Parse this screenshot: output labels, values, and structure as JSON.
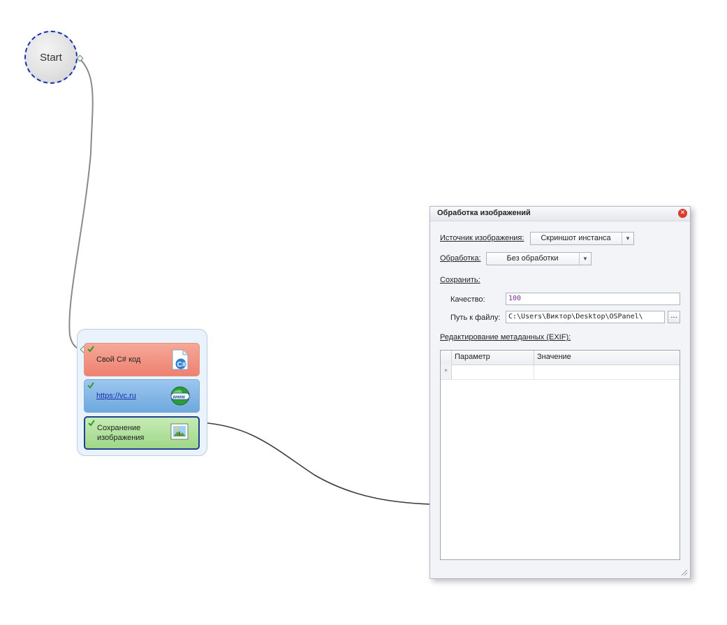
{
  "start_node": {
    "label": "Start"
  },
  "group": {
    "blocks": [
      {
        "label": "Свой C# код",
        "icon": "csharp-file-icon",
        "color": "#ee8170"
      },
      {
        "label": "https://vc.ru",
        "icon": "www-globe-icon",
        "color": "#6fa8de"
      },
      {
        "label_line1": "Сохранение",
        "label_line2": "изображения",
        "icon": "picture-icon",
        "color": "#9fd789"
      }
    ]
  },
  "dialog": {
    "title": "Обработка изображений",
    "source_label": "Источник изображения:",
    "source_value": "Скриншот инстанса",
    "processing_label": "Обработка:",
    "processing_value": "Без обработки",
    "save_label": "Сохранить:",
    "quality_label": "Качество:",
    "quality_value": "100",
    "path_label": "Путь к файлу:",
    "path_value": "C:\\Users\\Виктор\\Desktop\\OSPanel\\",
    "browse_label": "...",
    "exif_label": "Редактирование метаданных (EXIF):",
    "grid": {
      "columns": [
        "Параметр",
        "Значение"
      ],
      "new_row_marker": "*"
    }
  },
  "colors": {
    "accent_dashed": "#1a2fb8",
    "selected_border": "#1f3f8f",
    "close": "#d83a2e"
  }
}
